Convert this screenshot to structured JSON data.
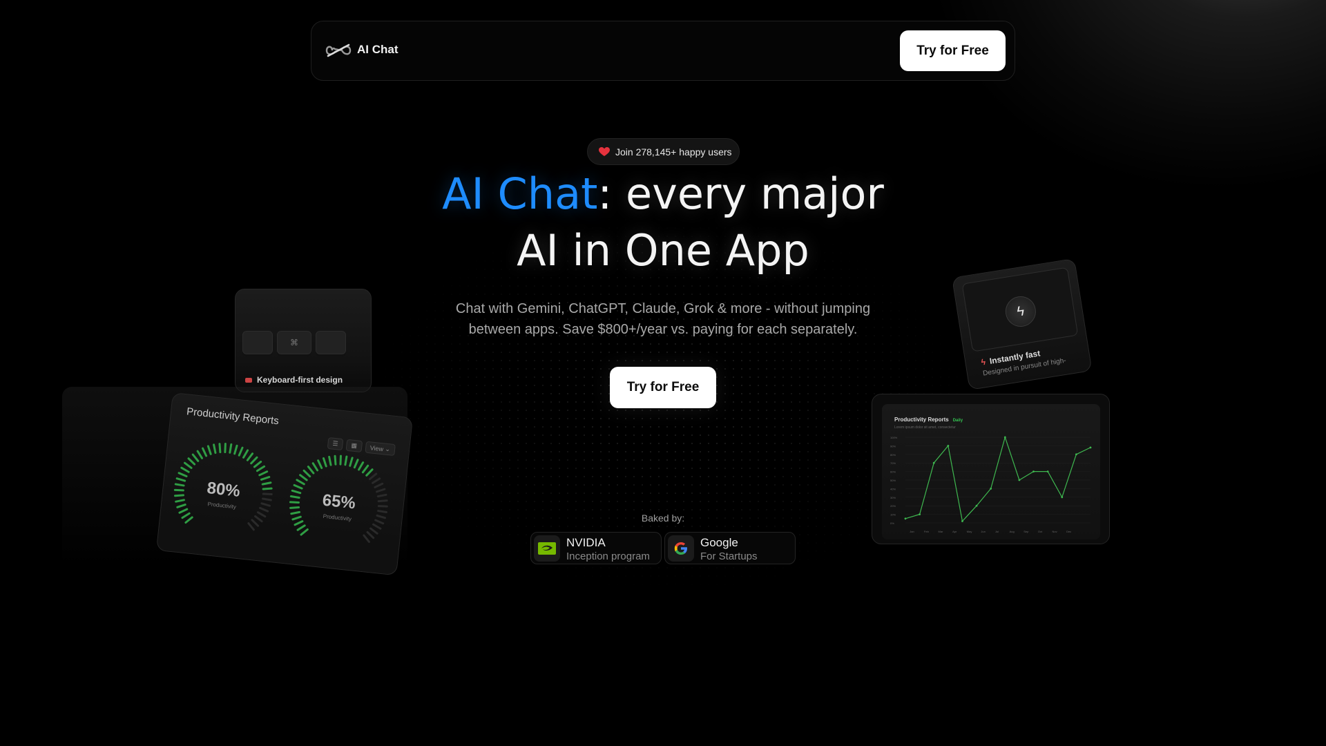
{
  "nav": {
    "brand": "AI Chat",
    "cta_label": "Try for Free"
  },
  "hero": {
    "badge_text": "Join 278,145+ happy users",
    "headline_accent": "AI Chat",
    "headline_rest_line1": ": every major",
    "headline_line2": "AI in One App",
    "subtitle_line1": "Chat with Gemini, ChatGPT, Claude, Grok & more - without jumping",
    "subtitle_line2": "between apps. Save $800+/year vs. paying for each separately.",
    "cta_label": "Try for Free"
  },
  "backed": {
    "label": "Baked by:",
    "partners": [
      {
        "name": "NVIDIA",
        "sub": "Inception program",
        "icon": "nvidia-logo-icon"
      },
      {
        "name": "Google",
        "sub": "For Startups",
        "icon": "google-logo-icon"
      }
    ]
  },
  "decor": {
    "keyboard_card": {
      "label": "Keyboard-first design",
      "key_glyph": "⌘"
    },
    "productivity_card": {
      "title": "Productivity Reports",
      "view_label": "View",
      "gauges": [
        {
          "value": "80%",
          "label": "Productivity",
          "fraction": 0.8
        },
        {
          "value": "65%",
          "label": "Productivity",
          "fraction": 0.65
        }
      ]
    },
    "fast_card": {
      "title": "Instantly fast",
      "subtitle": "Designed in pursuit of high-"
    },
    "chart_card": {
      "title": "Productivity Reports",
      "tag": "Daily",
      "subtitle": "Lorem ipsum dolor sit amet, consectetur"
    }
  },
  "colors": {
    "accent": "#1e8cff",
    "background": "#000000",
    "chart_line": "#3fb950"
  },
  "chart_data": {
    "type": "line",
    "title": "Productivity Reports",
    "ylim": [
      0,
      100
    ],
    "yticks": [
      "100%",
      "90%",
      "80%",
      "70%",
      "60%",
      "50%",
      "40%",
      "30%",
      "20%",
      "10%",
      "0%"
    ],
    "x": [
      "Jan",
      "Feb",
      "Mar",
      "Apr",
      "May",
      "Jun",
      "Jul",
      "Aug",
      "Sep",
      "Oct",
      "Nov",
      "Dec",
      ""
    ],
    "series": [
      {
        "values": [
          5,
          10,
          70,
          90,
          2,
          20,
          40,
          100,
          50,
          60,
          60,
          30,
          80,
          88
        ]
      }
    ]
  }
}
